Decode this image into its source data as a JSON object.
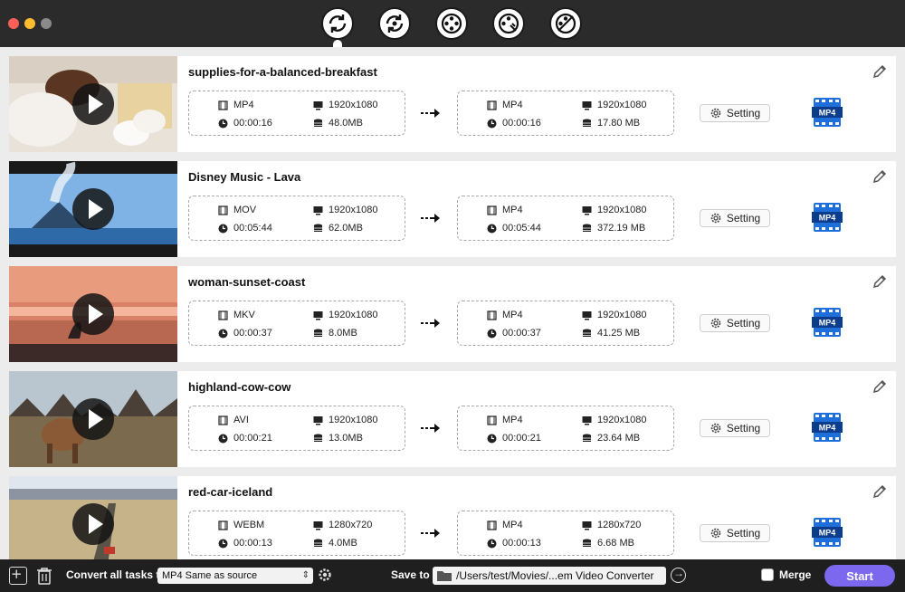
{
  "toolbar": {
    "buttons": [
      "convert-icon",
      "reverse-convert-icon",
      "film-reel-icon",
      "film-edit-icon",
      "film-remove-icon"
    ]
  },
  "tasks": [
    {
      "title": "supplies-for-a-balanced-breakfast",
      "source": {
        "format": "MP4",
        "resolution": "1920x1080",
        "duration": "00:00:16",
        "size": "48.0MB"
      },
      "output": {
        "format": "MP4",
        "resolution": "1920x1080",
        "duration": "00:00:16",
        "size": "17.80 MB"
      }
    },
    {
      "title": "Disney Music - Lava",
      "source": {
        "format": "MOV",
        "resolution": "1920x1080",
        "duration": "00:05:44",
        "size": "62.0MB"
      },
      "output": {
        "format": "MP4",
        "resolution": "1920x1080",
        "duration": "00:05:44",
        "size": "372.19 MB"
      }
    },
    {
      "title": "woman-sunset-coast",
      "source": {
        "format": "MKV",
        "resolution": "1920x1080",
        "duration": "00:00:37",
        "size": "8.0MB"
      },
      "output": {
        "format": "MP4",
        "resolution": "1920x1080",
        "duration": "00:00:37",
        "size": "41.25 MB"
      }
    },
    {
      "title": "highland-cow-cow",
      "source": {
        "format": "AVI",
        "resolution": "1920x1080",
        "duration": "00:00:21",
        "size": "13.0MB"
      },
      "output": {
        "format": "MP4",
        "resolution": "1920x1080",
        "duration": "00:00:21",
        "size": "23.64 MB"
      }
    },
    {
      "title": "red-car-iceland",
      "source": {
        "format": "WEBM",
        "resolution": "1280x720",
        "duration": "00:00:13",
        "size": "4.0MB"
      },
      "output": {
        "format": "MP4",
        "resolution": "1280x720",
        "duration": "00:00:13",
        "size": "6.68 MB"
      }
    }
  ],
  "setting_label": "Setting",
  "mp4_badge": "MP4",
  "bottom": {
    "convert_all_label": "Convert all tasks to",
    "convert_all_value": "MP4 Same as source",
    "save_to_label": "Save to",
    "save_path": "/Users/test/Movies/...em Video Converter",
    "merge_label": "Merge",
    "start_label": "Start"
  },
  "colors": {
    "accent": "#7b68ee",
    "close": "#ff5f57",
    "minimize": "#febc2e"
  }
}
